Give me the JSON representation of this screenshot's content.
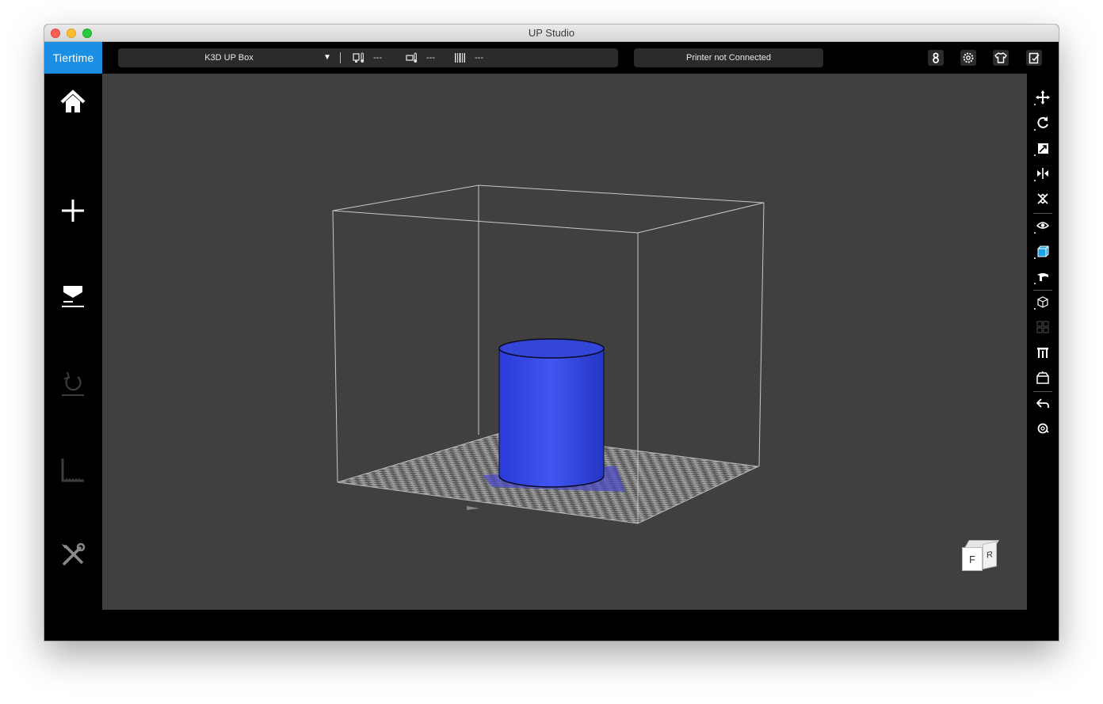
{
  "window": {
    "title": "UP Studio"
  },
  "topbar": {
    "logo": "Tiertime",
    "printer_name": "K3D UP Box",
    "dropdown_caret": "▼",
    "nozzle_temp": "---",
    "bed_temp": "---",
    "material": "---",
    "connection_status": "Printer not Connected"
  },
  "top_icons": [
    "account-icon",
    "settings-gear-icon",
    "shirt-icon",
    "clipboard-icon"
  ],
  "left_nav": [
    "home-icon",
    "add-icon",
    "print-icon",
    "calibrate-icon",
    "level-icon",
    "maintenance-icon"
  ],
  "right_tools": [
    "move-icon",
    "rotate-icon",
    "scale-icon",
    "mirror-icon",
    "auto-place-icon",
    "view-icon",
    "solid-view-icon",
    "edit-view-icon",
    "repair-icon",
    "layout-icon",
    "support-icon",
    "open-project-icon",
    "undo-icon",
    "reset-icon"
  ],
  "nav_cube": {
    "front": "F",
    "right": "R"
  },
  "colors": {
    "accent": "#1a8fe3",
    "viewport": "#404040",
    "model": "#3a4ee8"
  }
}
